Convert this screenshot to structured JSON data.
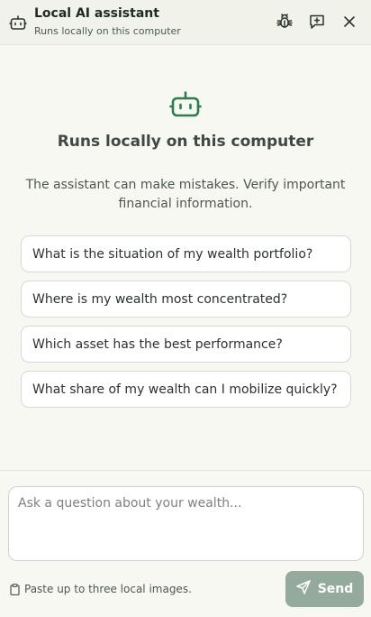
{
  "header": {
    "title": "Local AI assistant",
    "subtitle": "Runs locally on this computer",
    "icons": [
      "robot-icon",
      "bug-icon",
      "new-chat-icon",
      "close-icon"
    ]
  },
  "main": {
    "headline": "Runs locally on this computer",
    "disclaimer": "The assistant can make mistakes. Verify important financial information.",
    "suggestions": [
      "What is the situation of my wealth portfolio?",
      "Where is my wealth most concentrated?",
      "Which asset has the best performance?",
      "What share of my wealth can I mobilize quickly?"
    ]
  },
  "composer": {
    "placeholder": "Ask a question about your wealth...",
    "value": ""
  },
  "footer": {
    "paste_hint": "Paste up to three local images.",
    "send_label": "Send"
  },
  "colors": {
    "accent": "#2e7d4f",
    "send_disabled": "#93aa9c",
    "header_bg": "#f1f3ea",
    "page_bg": "#f8f8f2"
  }
}
